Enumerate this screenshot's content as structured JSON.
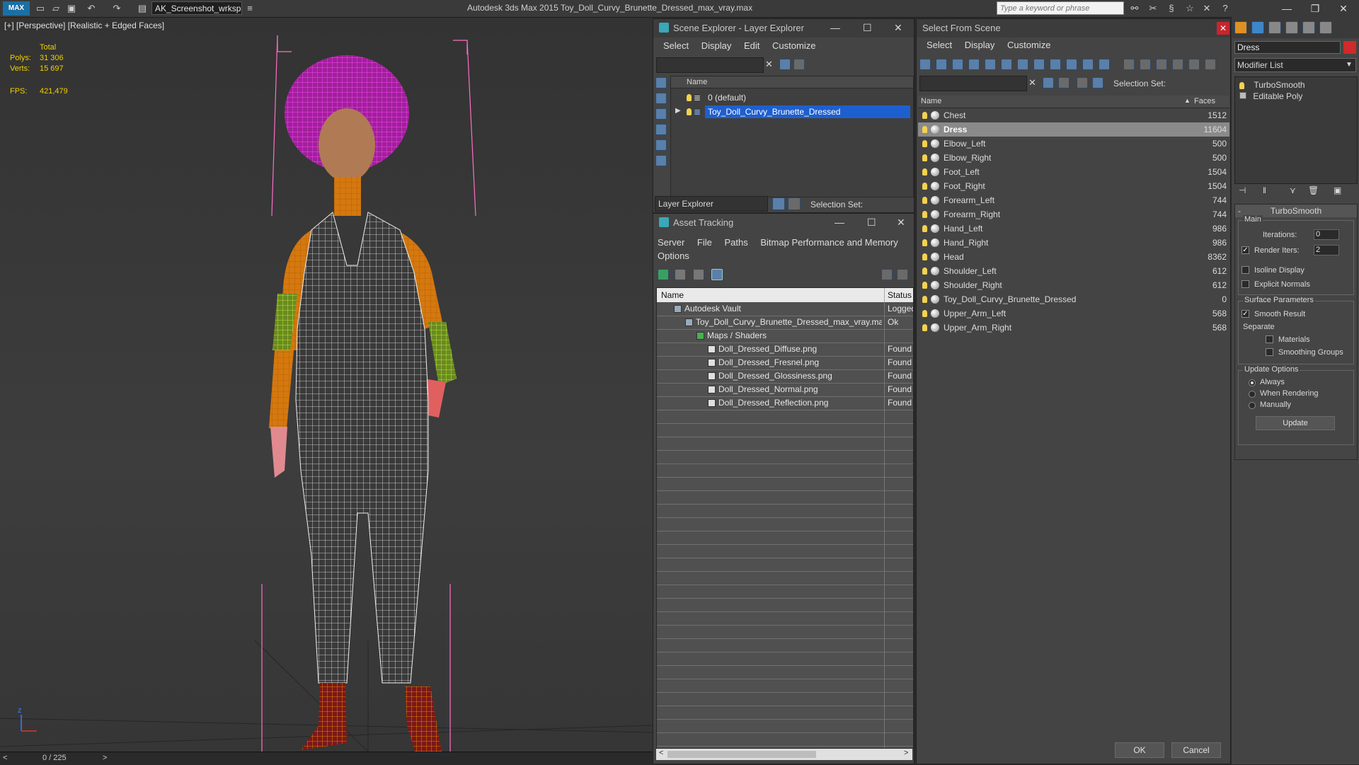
{
  "titlebar": {
    "logo": "MAX",
    "workspace": "AK_Screenshot_wrksp",
    "app_title": "Autodesk 3ds Max  2015    Toy_Doll_Curvy_Brunette_Dressed_max_vray.max",
    "search_placeholder": "Type a keyword or phrase"
  },
  "viewport": {
    "label": "[+] [Perspective] [Realistic + Edged Faces]",
    "stats": {
      "total_label": "Total",
      "polys_label": "Polys:",
      "polys_value": "31 306",
      "verts_label": "Verts:",
      "verts_value": "15 697",
      "fps_label": "FPS:",
      "fps_value": "421,479"
    },
    "axis_label": "z",
    "timeline": "0 / 225"
  },
  "scene_explorer": {
    "title": "Scene Explorer - Layer Explorer",
    "menu": [
      "Select",
      "Display",
      "Edit",
      "Customize"
    ],
    "col_name": "Name",
    "layers": [
      {
        "name": "0 (default)",
        "selected": false
      },
      {
        "name": "Toy_Doll_Curvy_Brunette_Dressed",
        "selected": true
      }
    ],
    "footer_combo": "Layer Explorer",
    "selection_set": "Selection Set:"
  },
  "asset_tracking": {
    "title": "Asset Tracking",
    "menu": [
      "Server",
      "File",
      "Paths",
      "Bitmap Performance and Memory"
    ],
    "menu2": "Options",
    "col_name": "Name",
    "col_status": "Status",
    "rows": [
      {
        "name": "Autodesk Vault",
        "status": "Logged",
        "indent": 1
      },
      {
        "name": "Toy_Doll_Curvy_Brunette_Dressed_max_vray.max",
        "status": "Ok",
        "indent": 2
      },
      {
        "name": "Maps / Shaders",
        "status": "",
        "indent": 3
      },
      {
        "name": "Doll_Dressed_Diffuse.png",
        "status": "Found",
        "indent": 4
      },
      {
        "name": "Doll_Dressed_Fresnel.png",
        "status": "Found",
        "indent": 4
      },
      {
        "name": "Doll_Dressed_Glossiness.png",
        "status": "Found",
        "indent": 4
      },
      {
        "name": "Doll_Dressed_Normal.png",
        "status": "Found",
        "indent": 4
      },
      {
        "name": "Doll_Dressed_Reflection.png",
        "status": "Found",
        "indent": 4
      }
    ]
  },
  "select_from_scene": {
    "title": "Select From Scene",
    "menu": [
      "Select",
      "Display",
      "Customize"
    ],
    "selection_set": "Selection Set:",
    "col_name": "Name",
    "col_faces": "Faces",
    "objects": [
      {
        "name": "Chest",
        "faces": "1512",
        "selected": false
      },
      {
        "name": "Dress",
        "faces": "11604",
        "selected": true
      },
      {
        "name": "Elbow_Left",
        "faces": "500",
        "selected": false
      },
      {
        "name": "Elbow_Right",
        "faces": "500",
        "selected": false
      },
      {
        "name": "Foot_Left",
        "faces": "1504",
        "selected": false
      },
      {
        "name": "Foot_Right",
        "faces": "1504",
        "selected": false
      },
      {
        "name": "Forearm_Left",
        "faces": "744",
        "selected": false
      },
      {
        "name": "Forearm_Right",
        "faces": "744",
        "selected": false
      },
      {
        "name": "Hand_Left",
        "faces": "986",
        "selected": false
      },
      {
        "name": "Hand_Right",
        "faces": "986",
        "selected": false
      },
      {
        "name": "Head",
        "faces": "8362",
        "selected": false
      },
      {
        "name": "Shoulder_Left",
        "faces": "612",
        "selected": false
      },
      {
        "name": "Shoulder_Right",
        "faces": "612",
        "selected": false
      },
      {
        "name": "Toy_Doll_Curvy_Brunette_Dressed",
        "faces": "0",
        "selected": false
      },
      {
        "name": "Upper_Arm_Left",
        "faces": "568",
        "selected": false
      },
      {
        "name": "Upper_Arm_Right",
        "faces": "568",
        "selected": false
      }
    ],
    "ok": "OK",
    "cancel": "Cancel"
  },
  "modify_panel": {
    "object_name": "Dress",
    "modifier_list": "Modifier List",
    "stack": [
      "TurboSmooth",
      "Editable Poly"
    ],
    "rollout_title": "TurboSmooth",
    "main_label": "Main",
    "iterations_label": "Iterations:",
    "iterations_value": "0",
    "render_iters_label": "Render Iters:",
    "render_iters_value": "2",
    "isoline": "Isoline Display",
    "explicit_normals": "Explicit Normals",
    "surface_params": "Surface Parameters",
    "smooth_result": "Smooth Result",
    "separate": "Separate",
    "materials": "Materials",
    "smoothing_groups": "Smoothing Groups",
    "update_options": "Update Options",
    "always": "Always",
    "when_rendering": "When Rendering",
    "manually": "Manually",
    "update_button": "Update"
  },
  "colors": {
    "selection_blue": "#1e5fcf",
    "stats_yellow": "#f0d000",
    "wire_magenta": "#ff33ff",
    "wire_orange": "#e07a10"
  }
}
